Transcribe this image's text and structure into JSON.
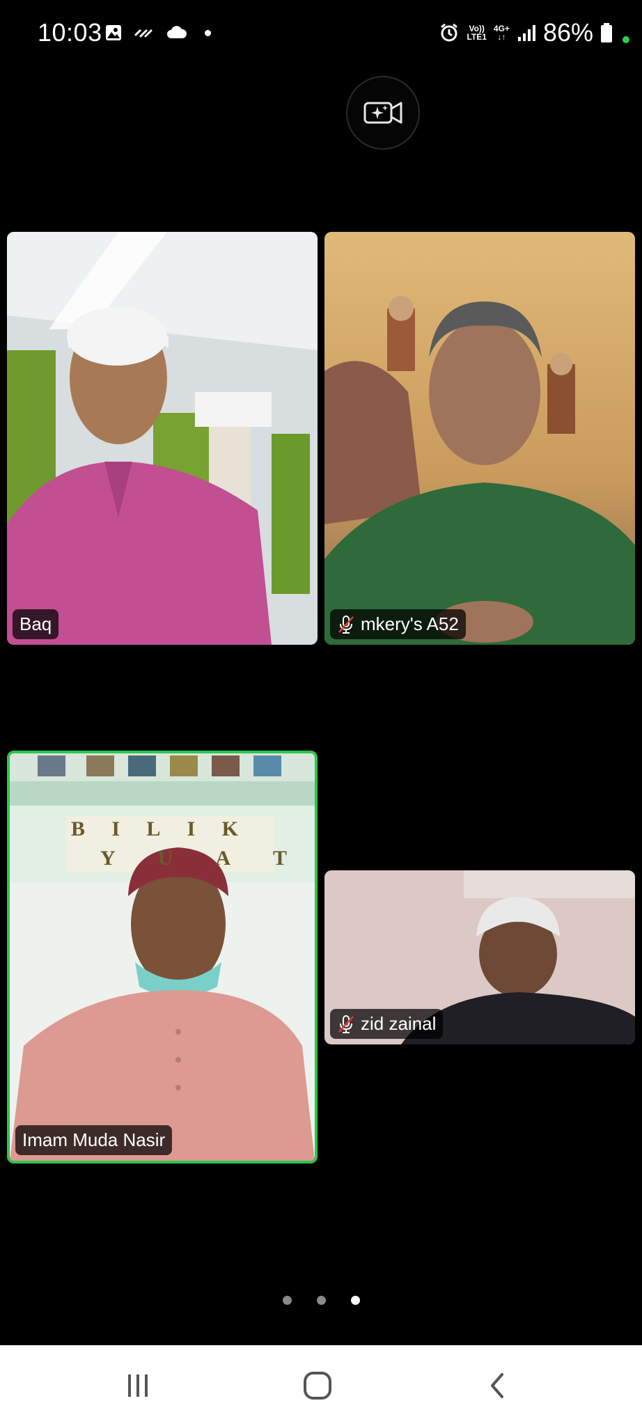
{
  "status_bar": {
    "time": "10:03",
    "network_top": "Vo))",
    "network_bottom": "LTE1",
    "data_type_top": "4G+",
    "data_type_bottom": "↓↑",
    "battery_percent": "86%"
  },
  "camera_effects_icon": "video-sparkle-icon",
  "participants": [
    {
      "name": "Baq",
      "muted": false,
      "active_speaker": false
    },
    {
      "name": "mkery's A52",
      "muted": true,
      "active_speaker": false
    },
    {
      "name": "Imam Muda Nasir",
      "muted": false,
      "active_speaker": true
    },
    {
      "name": "zid zainal",
      "muted": true,
      "active_speaker": false
    }
  ],
  "poster_letters": {
    "row1": [
      "B",
      "I",
      "L",
      "I",
      "K"
    ],
    "row2": [
      "Y",
      "U",
      "A",
      "T"
    ]
  },
  "pager": {
    "total": 3,
    "current": 3
  },
  "nav": {
    "recent_icon": "recent-apps-icon",
    "home_icon": "home-icon",
    "back_icon": "back-icon"
  },
  "colors": {
    "active_speaker_border": "#2cc64b",
    "background": "#000000",
    "navbar": "#ffffff"
  }
}
